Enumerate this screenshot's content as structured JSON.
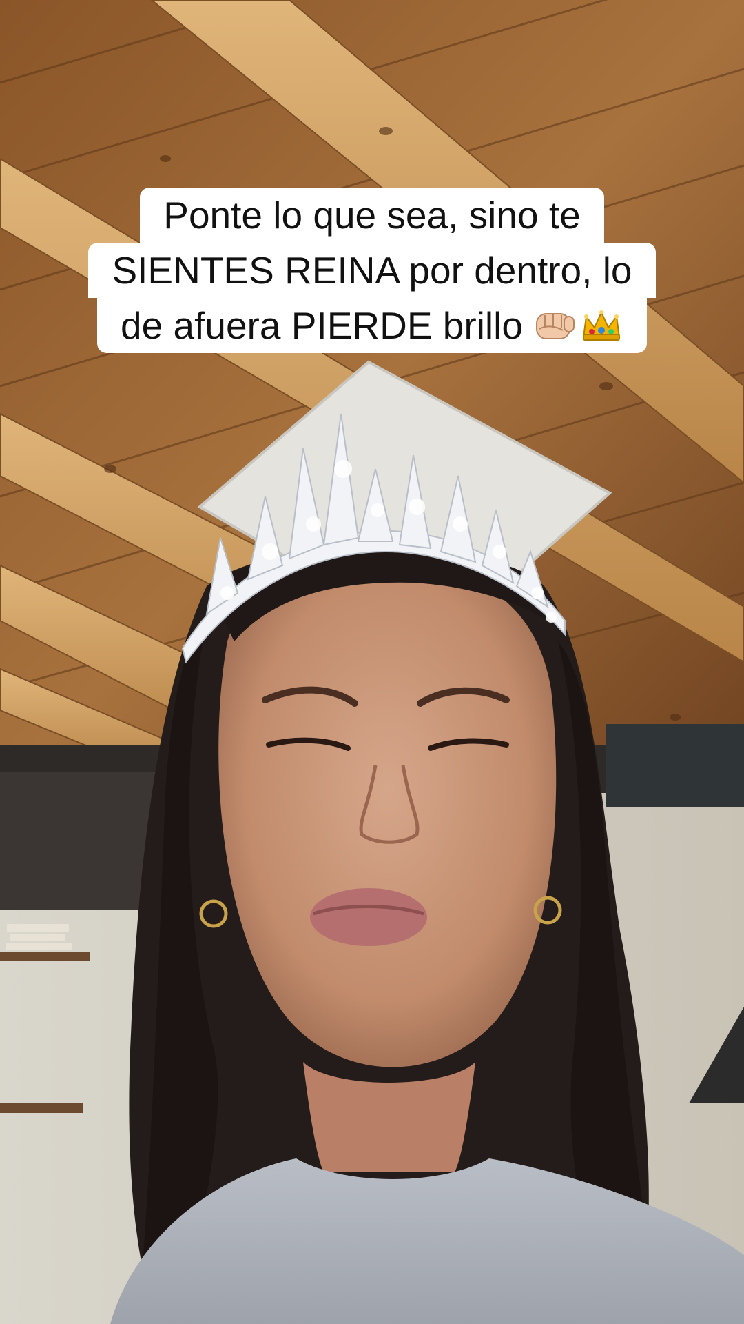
{
  "caption": {
    "line1": "Ponte lo que sea, sino te",
    "line2": "SIENTES REINA por dentro, lo",
    "line3": "de afuera PIERDE brillo",
    "emojis": [
      "fist-icon",
      "crown-icon"
    ]
  },
  "colors": {
    "caption_bg": "#ffffff",
    "caption_text": "#111111",
    "wood": "#a06a38",
    "beam": "#c99a5e"
  }
}
